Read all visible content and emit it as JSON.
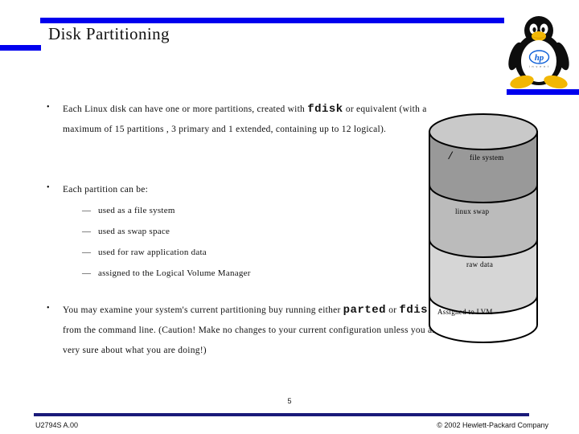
{
  "slide": {
    "title": "Disk Partitioning",
    "page_number": "5"
  },
  "logo": {
    "name": "tux-linux-penguin",
    "belly_brand": "hp",
    "belly_tagline": "invent"
  },
  "accent_colors": {
    "bar_blue": "#0000ee",
    "footer_rule": "#1a1a7a",
    "hp_blue": "#0b5ed7",
    "tux_yellow": "#f5c518"
  },
  "body": {
    "bullets": [
      {
        "marker": "•",
        "segments": [
          {
            "text": "Each Linux disk can have one or more partitions, created with ",
            "style": "normal"
          },
          {
            "text": "fdisk",
            "style": "mono"
          },
          {
            "text": " or equivalent (with a maximum of 15 partitions ,  3 primary and 1 extended, containing up to 12 logical).",
            "style": "normal"
          }
        ]
      },
      {
        "marker": "•",
        "segments": [
          {
            "text": "Each partition can be:",
            "style": "normal"
          }
        ],
        "sub_items": [
          {
            "dash": "—",
            "text": "used as a file system"
          },
          {
            "dash": "—",
            "text": "used as swap space"
          },
          {
            "dash": "—",
            "text": "used for raw application data"
          },
          {
            "dash": "—",
            "text": "assigned to the Logical Volume Manager"
          }
        ]
      },
      {
        "marker": "•",
        "segments": [
          {
            "text": "You may examine your system's current partitioning buy running either ",
            "style": "normal"
          },
          {
            "text": "parted",
            "style": "mono"
          },
          {
            "text": " or ",
            "style": "normal"
          },
          {
            "text": "fdisk",
            "style": "mono"
          },
          {
            "text": " from the command line.  (Caution! Make no changes to your current configuration unless you are very sure about what you are doing!)",
            "style": "normal"
          }
        ]
      }
    ]
  },
  "diagram": {
    "type": "disk-cylinder",
    "segments": [
      {
        "label": "file system",
        "prefix": "/",
        "fill": "#999999"
      },
      {
        "label": "linux swap",
        "prefix": "",
        "fill": "#bbbbbb"
      },
      {
        "label": "raw data",
        "prefix": "",
        "fill": "#d6d6d6"
      },
      {
        "label": "Assigned to LVM",
        "prefix": "",
        "fill": "#ffffff"
      }
    ],
    "top_fill": "#c9c9c9"
  },
  "footer": {
    "course_code": "U2794S A.00",
    "copyright": "© 2002 Hewlett-Packard Company"
  }
}
